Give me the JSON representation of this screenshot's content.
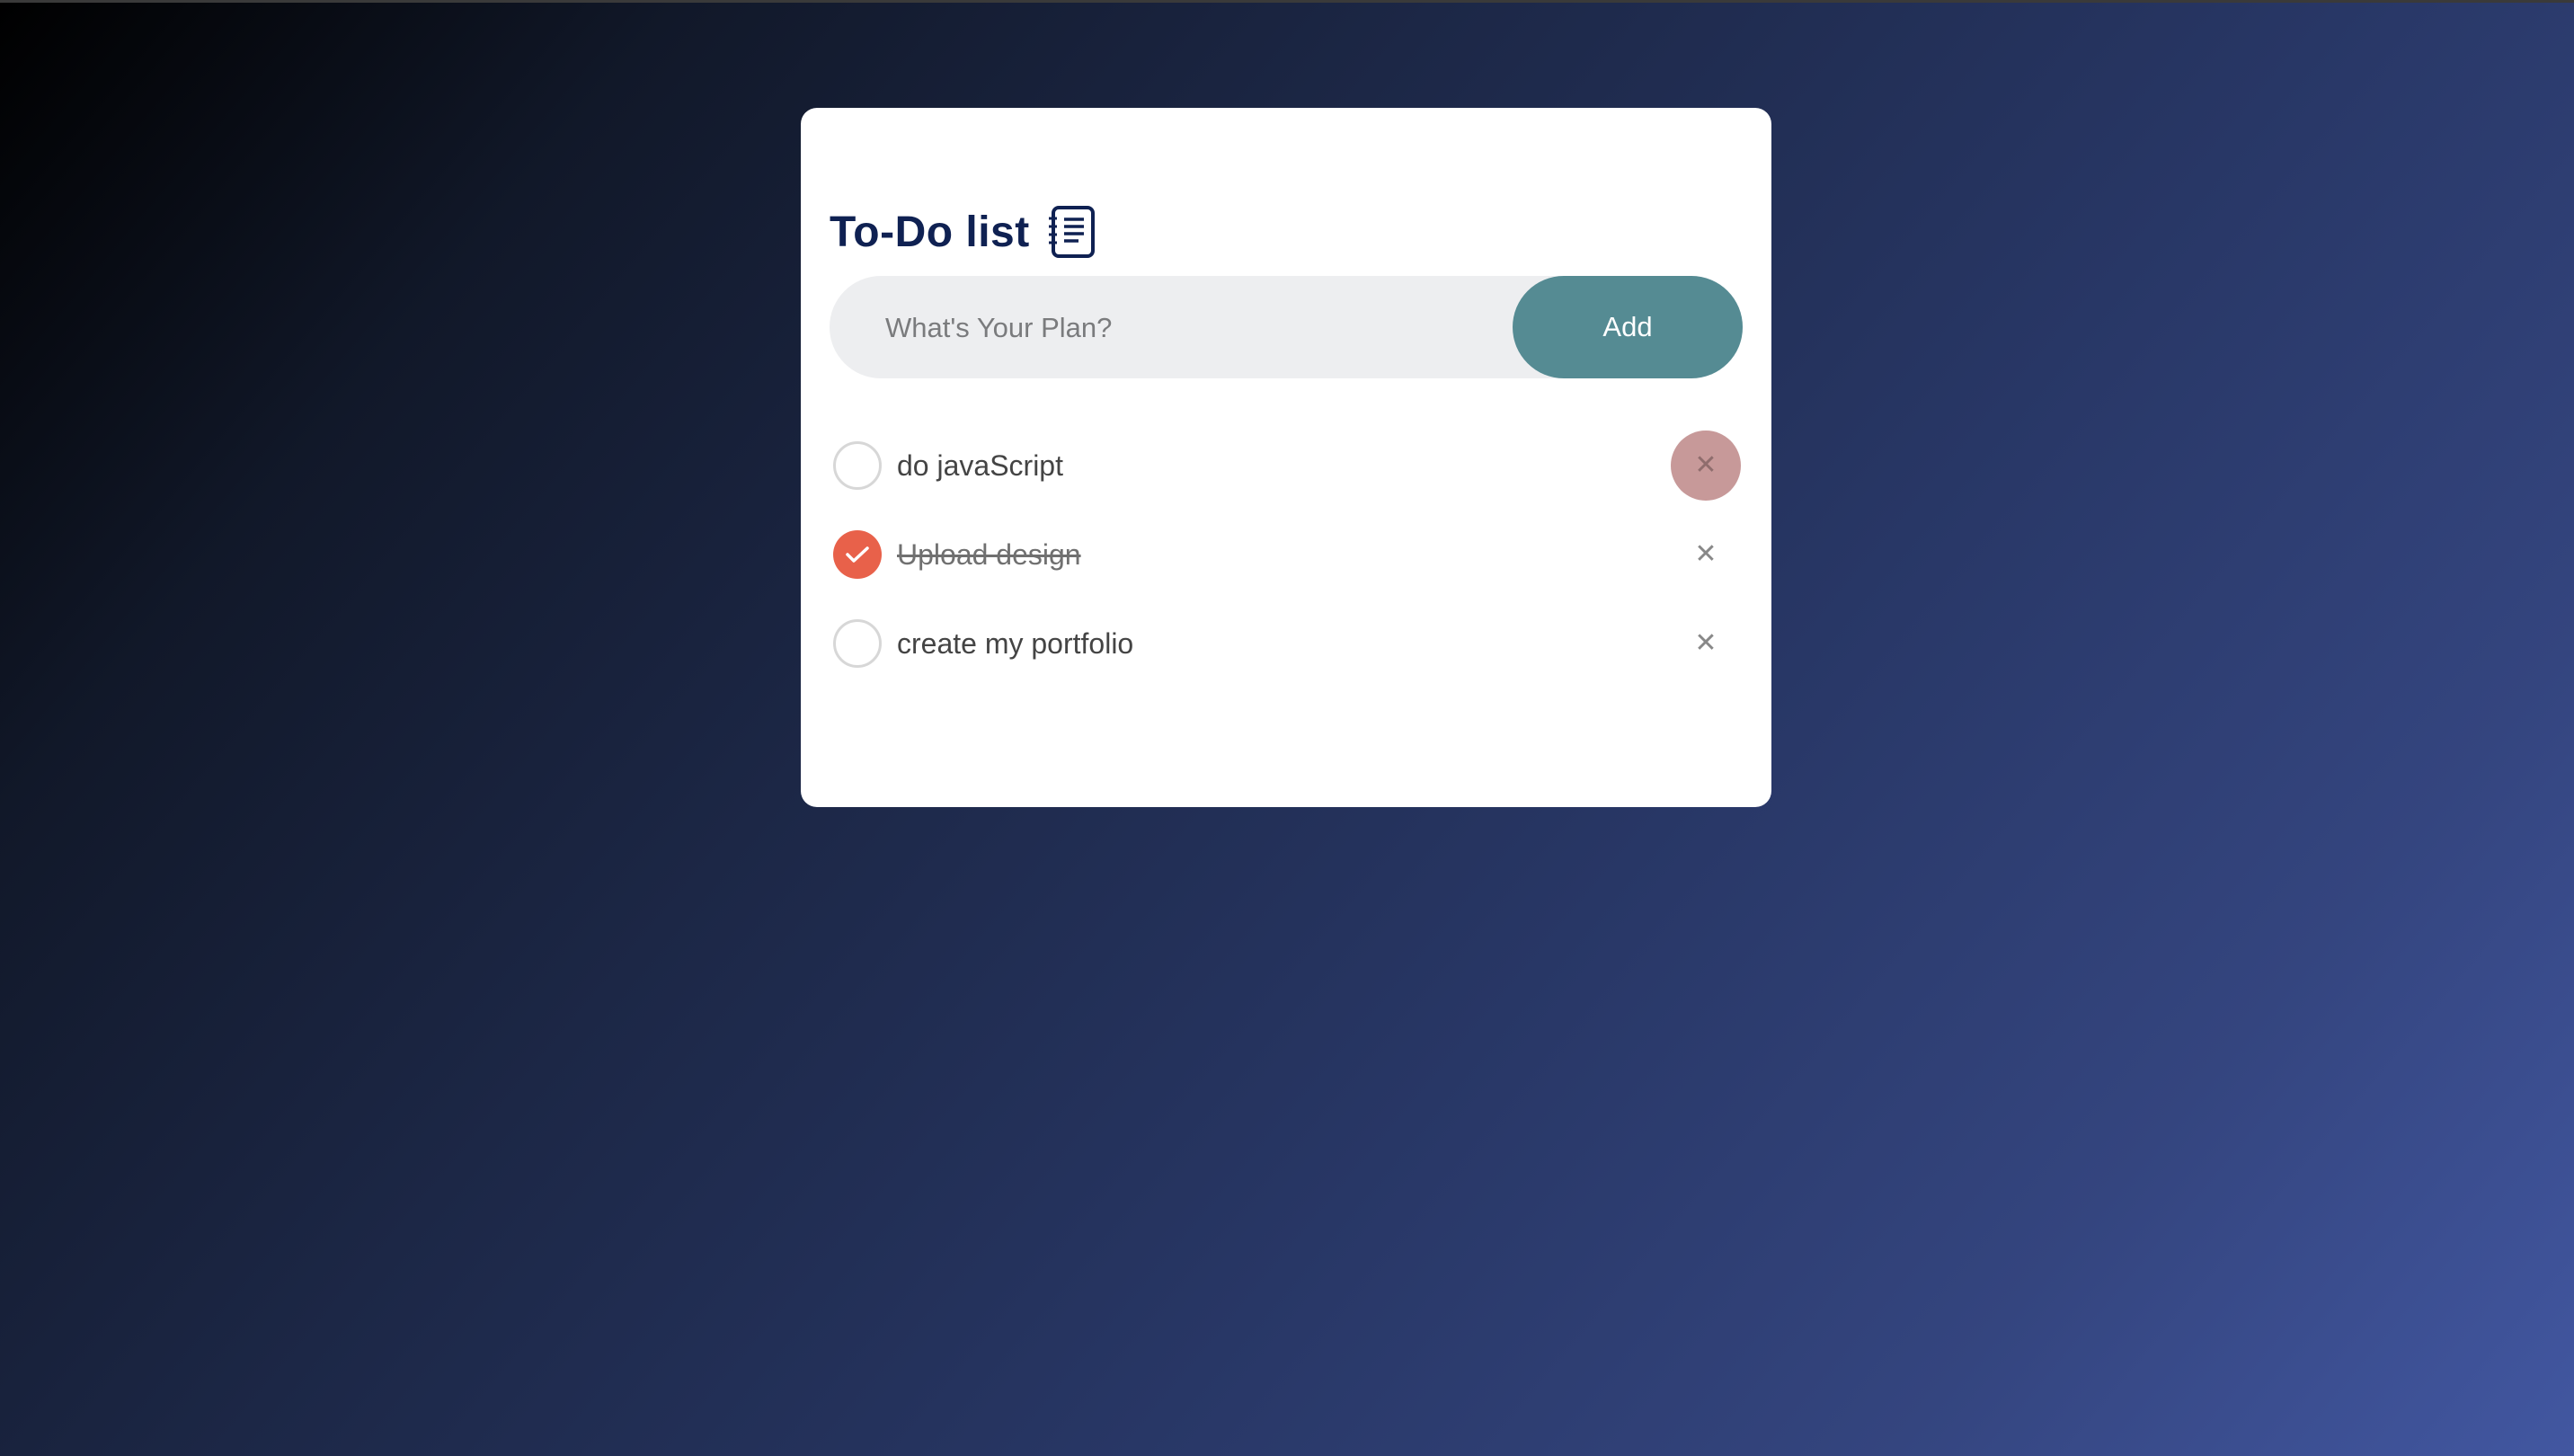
{
  "app": {
    "title": "To-Do list",
    "title_icon": "notebook-list-icon"
  },
  "input": {
    "placeholder": "What's Your Plan?",
    "value": "",
    "add_label": "Add"
  },
  "tasks": [
    {
      "text": "do javaScript",
      "checked": false,
      "delete_label": "✕",
      "delete_hovered": true
    },
    {
      "text": "Upload design",
      "checked": true,
      "delete_label": "✕",
      "delete_hovered": false
    },
    {
      "text": "create my portfolio",
      "checked": false,
      "delete_label": "✕",
      "delete_hovered": false
    }
  ],
  "colors": {
    "title": "#0f2152",
    "add_button": "#558b93",
    "checked": "#e8614a",
    "delete_hover": "#c79999",
    "input_bg": "#edeef0"
  },
  "icons": {
    "check": "check-icon",
    "delete": "close-icon"
  }
}
